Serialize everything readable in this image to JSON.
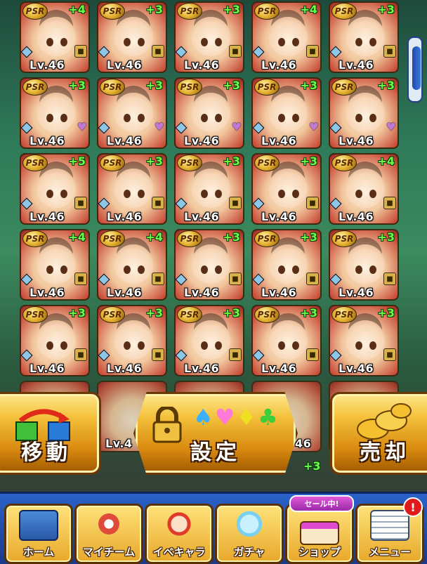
{
  "cards": [
    {
      "rarity": "PSR",
      "bonus": "+4",
      "level": "Lv.46",
      "status": "lock"
    },
    {
      "rarity": "PSR",
      "bonus": "+3",
      "level": "Lv.46",
      "status": "lock"
    },
    {
      "rarity": "PSR",
      "bonus": "+3",
      "level": "Lv.46",
      "status": "lock"
    },
    {
      "rarity": "PSR",
      "bonus": "+4",
      "level": "Lv.46",
      "status": "lock"
    },
    {
      "rarity": "PSR",
      "bonus": "+3",
      "level": "Lv.46",
      "status": "lock"
    },
    {
      "rarity": "PSR",
      "bonus": "+3",
      "level": "Lv.46",
      "status": "heart"
    },
    {
      "rarity": "PSR",
      "bonus": "+3",
      "level": "Lv.46",
      "status": "heart"
    },
    {
      "rarity": "PSR",
      "bonus": "+3",
      "level": "Lv.46",
      "status": "heart"
    },
    {
      "rarity": "PSR",
      "bonus": "+3",
      "level": "Lv.46",
      "status": "heart"
    },
    {
      "rarity": "PSR",
      "bonus": "+3",
      "level": "Lv.46",
      "status": "heart"
    },
    {
      "rarity": "PSR",
      "bonus": "+5",
      "level": "Lv.46",
      "status": "lock"
    },
    {
      "rarity": "PSR",
      "bonus": "+3",
      "level": "Lv.46",
      "status": "lock"
    },
    {
      "rarity": "PSR",
      "bonus": "+3",
      "level": "Lv.46",
      "status": "lock"
    },
    {
      "rarity": "PSR",
      "bonus": "+3",
      "level": "Lv.46",
      "status": "lock"
    },
    {
      "rarity": "PSR",
      "bonus": "+4",
      "level": "Lv.46",
      "status": "lock"
    },
    {
      "rarity": "PSR",
      "bonus": "+4",
      "level": "Lv.46",
      "status": "lock"
    },
    {
      "rarity": "PSR",
      "bonus": "+4",
      "level": "Lv.46",
      "status": "lock"
    },
    {
      "rarity": "PSR",
      "bonus": "+3",
      "level": "Lv.46",
      "status": "lock"
    },
    {
      "rarity": "PSR",
      "bonus": "+3",
      "level": "Lv.46",
      "status": "lock"
    },
    {
      "rarity": "PSR",
      "bonus": "+3",
      "level": "Lv.46",
      "status": "lock"
    },
    {
      "rarity": "PSR",
      "bonus": "+3",
      "level": "Lv.46",
      "status": "lock"
    },
    {
      "rarity": "PSR",
      "bonus": "+3",
      "level": "Lv.46",
      "status": "lock"
    },
    {
      "rarity": "PSR",
      "bonus": "+3",
      "level": "Lv.46",
      "status": "lock"
    },
    {
      "rarity": "PSR",
      "bonus": "+3",
      "level": "Lv.46",
      "status": "lock"
    },
    {
      "rarity": "PSR",
      "bonus": "+3",
      "level": "Lv.46",
      "status": "lock"
    }
  ],
  "partial_row": {
    "level_fragment_1": "Lv.4",
    "level_fragment_2": "46",
    "bonus": "+3"
  },
  "actions": {
    "move_label": "移動",
    "setting_label": "設定",
    "sell_label": "売却"
  },
  "nav": {
    "items": [
      {
        "label": "ホーム",
        "icon": "home-book-icon"
      },
      {
        "label": "マイチーム",
        "icon": "team-icon"
      },
      {
        "label": "イベキャラ",
        "icon": "event-character-icon"
      },
      {
        "label": "ガチャ",
        "icon": "gacha-capsule-icon"
      },
      {
        "label": "ショップ",
        "icon": "shop-icon"
      },
      {
        "label": "メニュー",
        "icon": "menu-list-icon"
      }
    ],
    "sale_badge": "セール中!",
    "notice_badge": "!"
  },
  "colors": {
    "bonus_green": "#6cff4a",
    "nav_blue": "#2a62c8",
    "button_gold": "#f3c03a",
    "notice_red": "#e01a1a",
    "sale_purple": "#c04ad0"
  }
}
